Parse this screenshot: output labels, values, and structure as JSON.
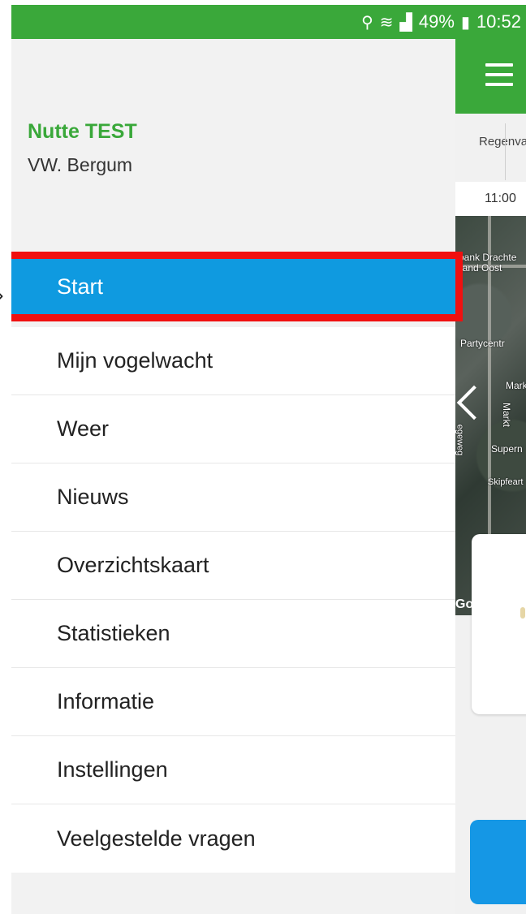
{
  "status_bar": {
    "location_icon": "location-pin-icon",
    "wifi_icon": "wifi-icon",
    "signal_icon": "signal-icon",
    "battery_percent": "49%",
    "battery_icon": "battery-charging-icon",
    "time": "10:52"
  },
  "drawer": {
    "user_name": "Nutte TEST",
    "club": "VW. Bergum",
    "menu": [
      {
        "label": "Start",
        "active": true
      },
      {
        "label": "Mijn vogelwacht"
      },
      {
        "label": "Weer"
      },
      {
        "label": "Nieuws"
      },
      {
        "label": "Overzichtskaart"
      },
      {
        "label": "Statistieken"
      },
      {
        "label": "Informatie"
      },
      {
        "label": "Instellingen"
      },
      {
        "label": "Veelgestelde vragen"
      }
    ]
  },
  "background_app": {
    "weather_label": "Regenva",
    "time_label": "11:00",
    "map_labels": [
      "bank Drachte",
      "land Oost",
      "Partycentr",
      "Mark",
      "Markt",
      "Supern",
      "Skipfeart",
      "egeweg"
    ],
    "google_label": "Go"
  },
  "colors": {
    "brand_green": "#3aa83a",
    "active_blue": "#0f9ae0",
    "highlight_red": "#f01010"
  }
}
